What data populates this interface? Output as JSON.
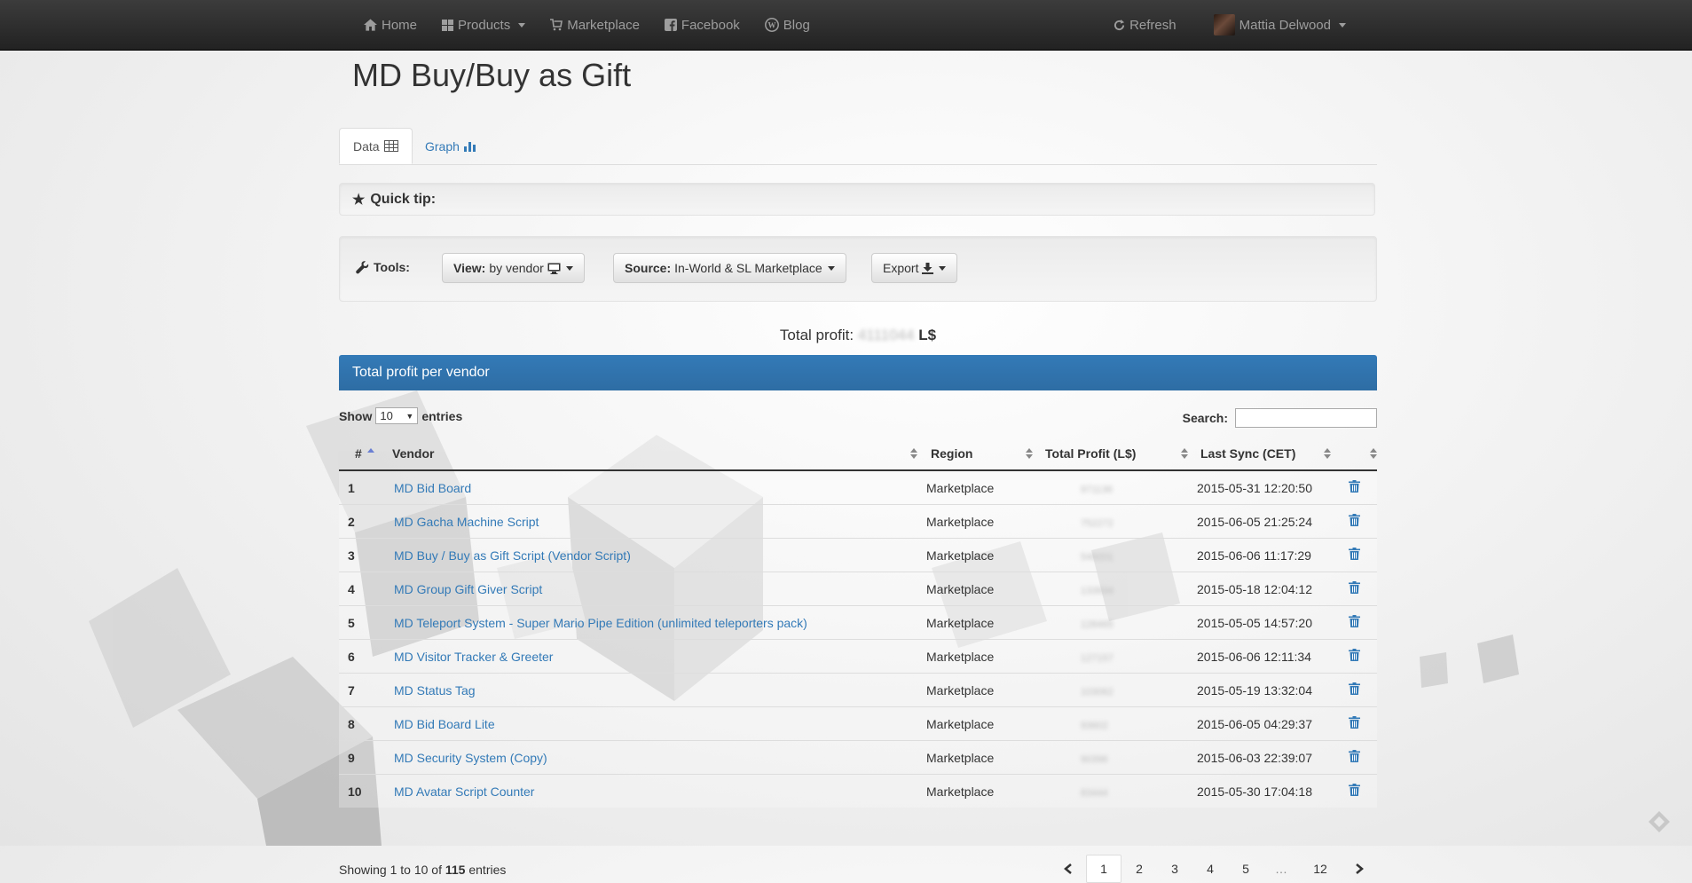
{
  "nav": {
    "home": "Home",
    "products": "Products",
    "marketplace": "Marketplace",
    "facebook": "Facebook",
    "blog": "Blog",
    "refresh": "Refresh",
    "user": "Mattia Delwood"
  },
  "page": {
    "title": "MD Buy/Buy as Gift"
  },
  "tabs": {
    "data": "Data",
    "graph": "Graph"
  },
  "tip": {
    "label": "Quick tip:"
  },
  "tools": {
    "label": "Tools:",
    "view_label": "View:",
    "view_value": "by vendor",
    "source_label": "Source:",
    "source_value": "In-World & SL Marketplace",
    "export": "Export"
  },
  "total": {
    "label": "Total profit:",
    "value": "4111044",
    "unit": "L$"
  },
  "panel": {
    "title": "Total profit per vendor"
  },
  "table_controls": {
    "show": "Show",
    "entries_value": "10",
    "entries": "entries",
    "search": "Search:"
  },
  "table": {
    "headers": [
      "#",
      "Vendor",
      "Region",
      "Total Profit (L$)",
      "Last Sync (CET)"
    ],
    "rows": [
      {
        "n": "1",
        "vendor": "MD Bid Board",
        "region": "Marketplace",
        "profit": "971136",
        "sync": "2015-05-31 12:20:50"
      },
      {
        "n": "2",
        "vendor": "MD Gacha Machine Script",
        "region": "Marketplace",
        "profit": "752272",
        "sync": "2015-06-05 21:25:24"
      },
      {
        "n": "3",
        "vendor": "MD Buy / Buy as Gift Script (Vendor Script)",
        "region": "Marketplace",
        "profit": "549201",
        "sync": "2015-06-06 11:17:29"
      },
      {
        "n": "4",
        "vendor": "MD Group Gift Giver Script",
        "region": "Marketplace",
        "profit": "133934",
        "sync": "2015-05-18 12:04:12"
      },
      {
        "n": "5",
        "vendor": "MD Teleport System - Super Mario Pipe Edition (unlimited teleporters pack)",
        "region": "Marketplace",
        "profit": "128465",
        "sync": "2015-05-05 14:57:20"
      },
      {
        "n": "6",
        "vendor": "MD Visitor Tracker & Greeter",
        "region": "Marketplace",
        "profit": "127157",
        "sync": "2015-06-06 12:11:34"
      },
      {
        "n": "7",
        "vendor": "MD Status Tag",
        "region": "Marketplace",
        "profit": "103062",
        "sync": "2015-05-19 13:32:04"
      },
      {
        "n": "8",
        "vendor": "MD Bid Board Lite",
        "region": "Marketplace",
        "profit": "93602",
        "sync": "2015-06-05 04:29:37"
      },
      {
        "n": "9",
        "vendor": "MD Security System (Copy)",
        "region": "Marketplace",
        "profit": "90396",
        "sync": "2015-06-03 22:39:07"
      },
      {
        "n": "10",
        "vendor": "MD Avatar Script Counter",
        "region": "Marketplace",
        "profit": "83444",
        "sync": "2015-05-30 17:04:18"
      }
    ]
  },
  "footer": {
    "info_prefix": "Showing 1 to 10 of",
    "total_entries": "115",
    "info_suffix": "entries",
    "pages": [
      "1",
      "2",
      "3",
      "4",
      "5",
      "…",
      "12"
    ]
  },
  "icons": {
    "home": "home-icon",
    "products": "grid-icon",
    "marketplace": "cart-icon",
    "facebook": "facebook-icon",
    "blog": "wordpress-icon",
    "refresh": "refresh-icon",
    "trash": "trash-icon",
    "star": "star-icon",
    "wrench": "wrench-icon"
  },
  "colors": {
    "link": "#337ab7",
    "panel": "#2e6da4",
    "navbar": "#222222"
  }
}
